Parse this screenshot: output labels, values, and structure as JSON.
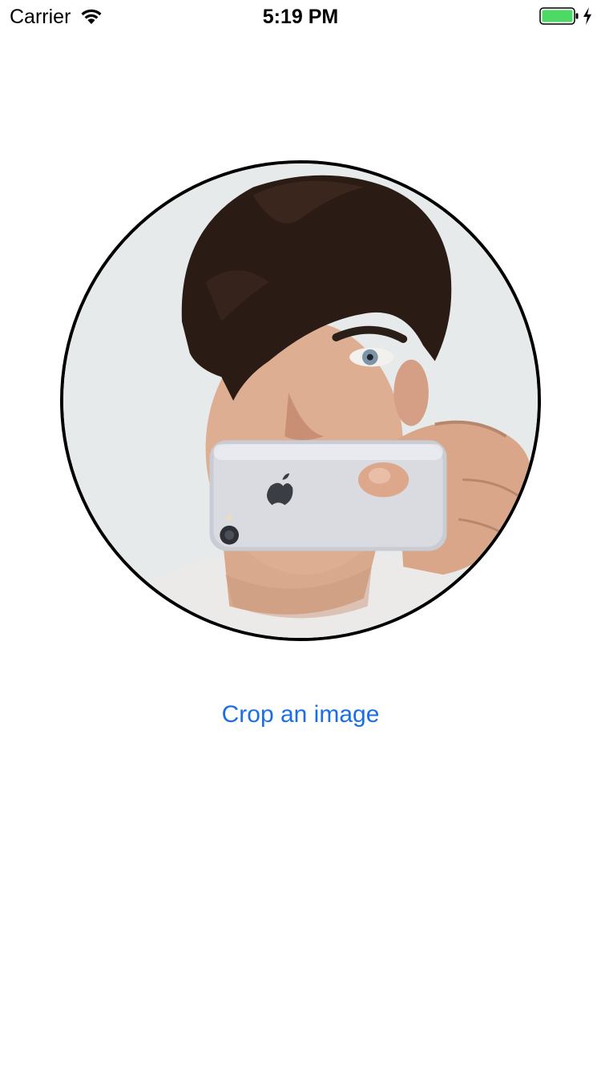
{
  "status_bar": {
    "carrier": "Carrier",
    "time": "5:19 PM",
    "wifi_icon": "wifi-icon",
    "battery_icon": "battery-full-icon",
    "charging_icon": "charging-bolt-icon",
    "battery_color": "#4cd964"
  },
  "main": {
    "image": {
      "description_icon": "cropped-photo",
      "border_color": "#000000"
    },
    "crop_button_label": "Crop an image",
    "accent_color": "#1a6fe8"
  }
}
